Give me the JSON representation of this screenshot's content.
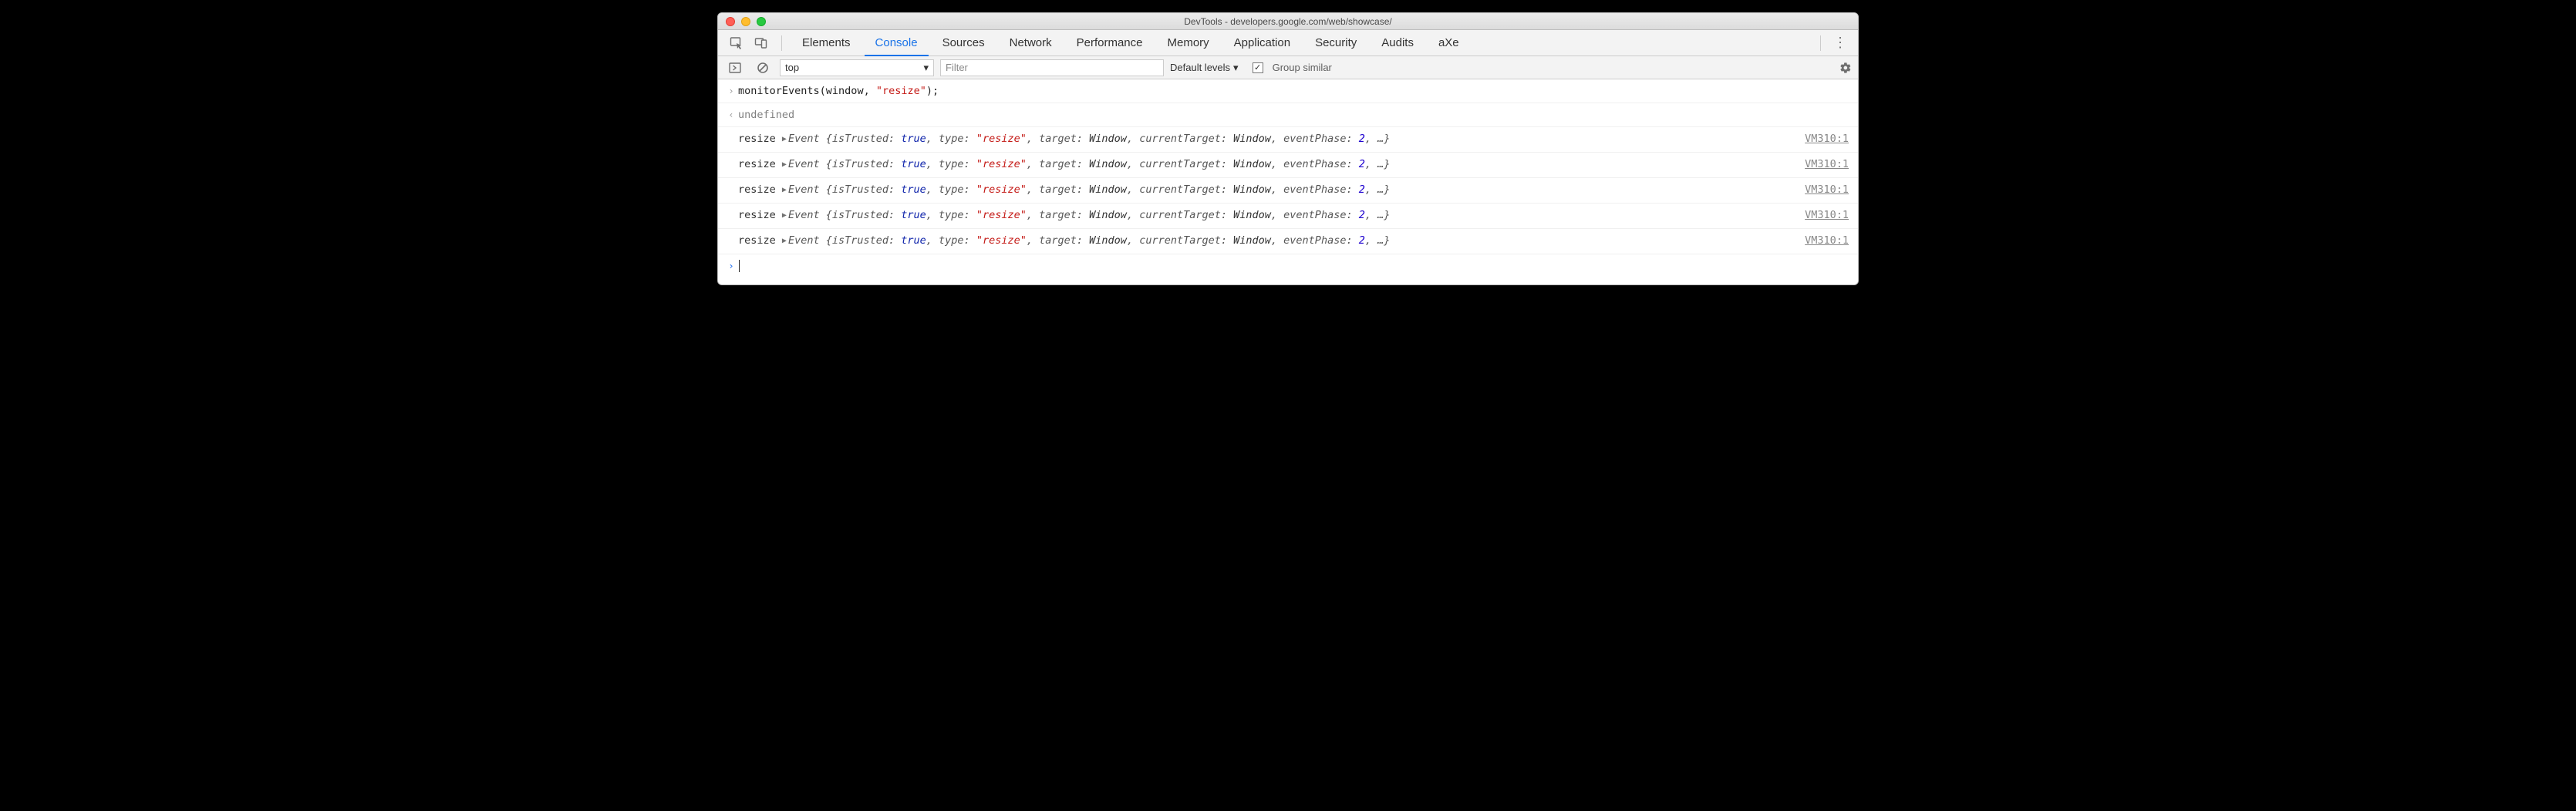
{
  "window": {
    "title": "DevTools - developers.google.com/web/showcase/"
  },
  "tabs": {
    "items": [
      "Elements",
      "Console",
      "Sources",
      "Network",
      "Performance",
      "Memory",
      "Application",
      "Security",
      "Audits",
      "aXe"
    ],
    "activeIndex": 1
  },
  "toolbar": {
    "context": "top",
    "filter_placeholder": "Filter",
    "levels_label": "Default levels",
    "group_label": "Group similar",
    "group_checked": true
  },
  "console": {
    "input_line": {
      "fn": "monitorEvents",
      "args_open": "(window, ",
      "str": "\"resize\"",
      "args_close": ");"
    },
    "result": "undefined",
    "events": [
      {
        "name": "resize",
        "source": "VM310:1",
        "obj": {
          "cls": "Event",
          "isTrusted": "true",
          "type": "\"resize\"",
          "target": "Window",
          "currentTarget": "Window",
          "eventPhase": "2"
        }
      },
      {
        "name": "resize",
        "source": "VM310:1",
        "obj": {
          "cls": "Event",
          "isTrusted": "true",
          "type": "\"resize\"",
          "target": "Window",
          "currentTarget": "Window",
          "eventPhase": "2"
        }
      },
      {
        "name": "resize",
        "source": "VM310:1",
        "obj": {
          "cls": "Event",
          "isTrusted": "true",
          "type": "\"resize\"",
          "target": "Window",
          "currentTarget": "Window",
          "eventPhase": "2"
        }
      },
      {
        "name": "resize",
        "source": "VM310:1",
        "obj": {
          "cls": "Event",
          "isTrusted": "true",
          "type": "\"resize\"",
          "target": "Window",
          "currentTarget": "Window",
          "eventPhase": "2"
        }
      },
      {
        "name": "resize",
        "source": "VM310:1",
        "obj": {
          "cls": "Event",
          "isTrusted": "true",
          "type": "\"resize\"",
          "target": "Window",
          "currentTarget": "Window",
          "eventPhase": "2"
        }
      }
    ]
  }
}
